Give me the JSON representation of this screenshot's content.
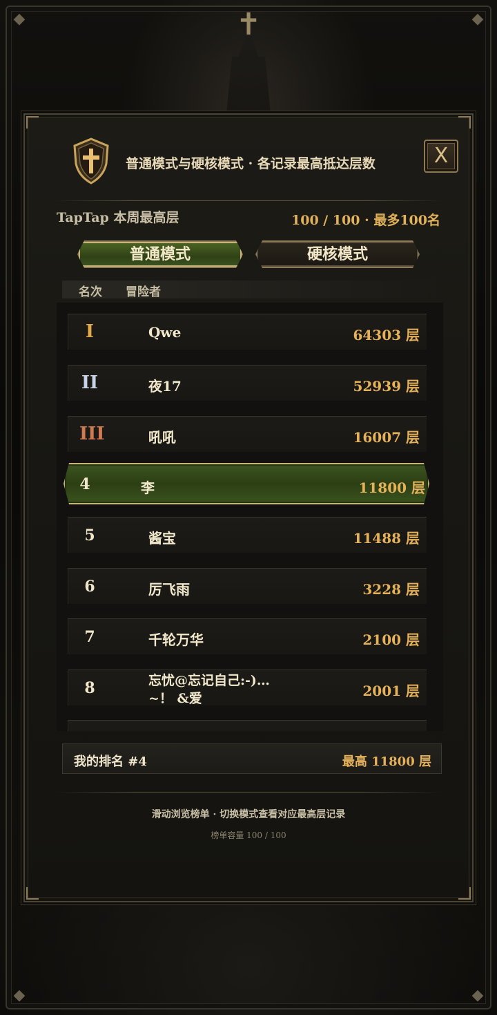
{
  "header": {
    "title": "普通模式与硬核模式 · 各记录最高抵达层数",
    "close_label": "X"
  },
  "summary": {
    "board_name": "TapTap 本周最高层",
    "capacity": "100 / 100 · 最多100名"
  },
  "tabs": [
    {
      "label": "普通模式",
      "active": true
    },
    {
      "label": "硬核模式",
      "active": false
    }
  ],
  "columns": {
    "rank": "名次",
    "player": "冒险者"
  },
  "rows": [
    {
      "rank": "I",
      "name": "Qwe",
      "score": "64303 层"
    },
    {
      "rank": "II",
      "name": "夜17",
      "score": "52939 层"
    },
    {
      "rank": "III",
      "name": "吼吼",
      "score": "16007 层"
    },
    {
      "rank": "4",
      "name": "李",
      "score": "11800 层"
    },
    {
      "rank": "5",
      "name": "酱宝",
      "score": "11488 层"
    },
    {
      "rank": "6",
      "name": "厉飞雨",
      "score": "3228 层"
    },
    {
      "rank": "7",
      "name": "千轮万华",
      "score": "2100 层"
    },
    {
      "rank": "8",
      "name": "忘忧@忘记自己:-)…~！ &爱",
      "score": "2001 层"
    }
  ],
  "my_rank": {
    "label": "我的排名  #4",
    "best": "最高 11800 层"
  },
  "footer": {
    "hint": "滑动浏览榜单 · 切换模式查看对应最高层记录",
    "capacity_note": "榜单容量 100 / 100"
  },
  "colors": {
    "gold": "#e5b25a",
    "active_tab": "#3c5320",
    "rank_gold": "#e0a94a",
    "rank_silver": "#c8d4e8",
    "rank_bronze": "#cf7b52"
  },
  "icons": {
    "emblem": "shield-cross-icon",
    "close": "close-icon"
  }
}
